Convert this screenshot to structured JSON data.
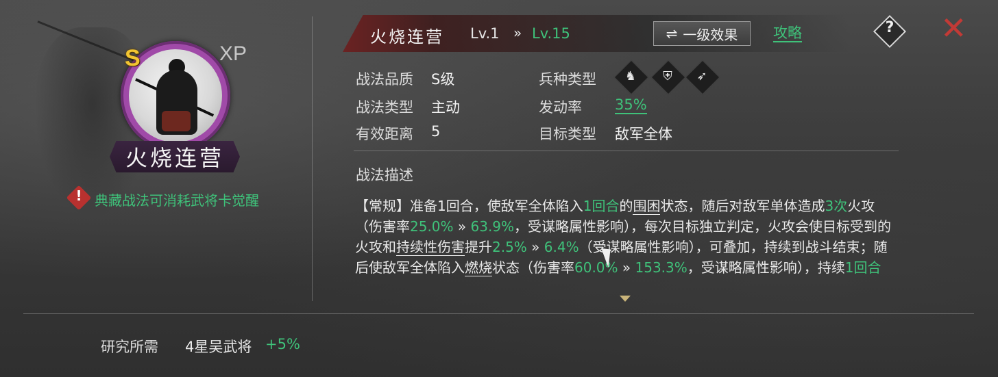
{
  "skill": {
    "name": "火烧连营",
    "grade_badge": "S",
    "xp_badge": "XP",
    "awaken_note": "典藏战法可消耗武将卡觉醒"
  },
  "header": {
    "title": "火烧连营",
    "level_from": "Lv.1",
    "level_arrow": "»",
    "level_to": "Lv.15",
    "effect_button": "一级效果",
    "effect_icon": "⇌",
    "guide_link": "攻略",
    "help_icon": "?",
    "close_icon": "✕"
  },
  "attributes": {
    "quality_label": "战法品质",
    "quality_value": "S级",
    "type_label": "战法类型",
    "type_value": "主动",
    "range_label": "有效距离",
    "range_value": "5",
    "troop_label": "兵种类型",
    "troop_icons": [
      "cavalry-icon",
      "shield-icon",
      "bow-icon"
    ],
    "rate_label": "发动率",
    "rate_value": "35%",
    "target_label": "目标类型",
    "target_value": "敌军全体"
  },
  "description": {
    "title": "战法描述",
    "t1": "【常规】准备1回合，使敌军全体陷入",
    "t2": "1回合",
    "t3": "的",
    "t4": "围困",
    "t5": "状态，随后对敌军单体造成",
    "t6": "3次",
    "t7": "火攻（伤害率",
    "t8": "25.0%",
    "t9": " » ",
    "t10": "63.9%",
    "t11": "，受谋略属性影响），每次目标独立判定，火攻会使目标受到的火攻和",
    "t12": "持续性伤害",
    "t13": "提升",
    "t14": "2.5%",
    "t15": " » ",
    "t16": "6.4%",
    "t17": "（受谋略属性影响），可叠加，持续到战斗结束；随后使敌军全体陷入",
    "t18": "燃烧",
    "t19": "状态（伤害率",
    "t20": "60.0%",
    "t21": " » ",
    "t22": "153.3%",
    "t23": "，受谋略属性影响），持续",
    "t24": "1回合"
  },
  "research": {
    "label": "研究所需",
    "value": "4星吴武将",
    "bonus": "+5%"
  },
  "colors": {
    "accent_green": "#3fc27a",
    "close_red": "#c23a36",
    "grade_gold": "#f2c531",
    "frame_purple": "#a04aa8"
  }
}
